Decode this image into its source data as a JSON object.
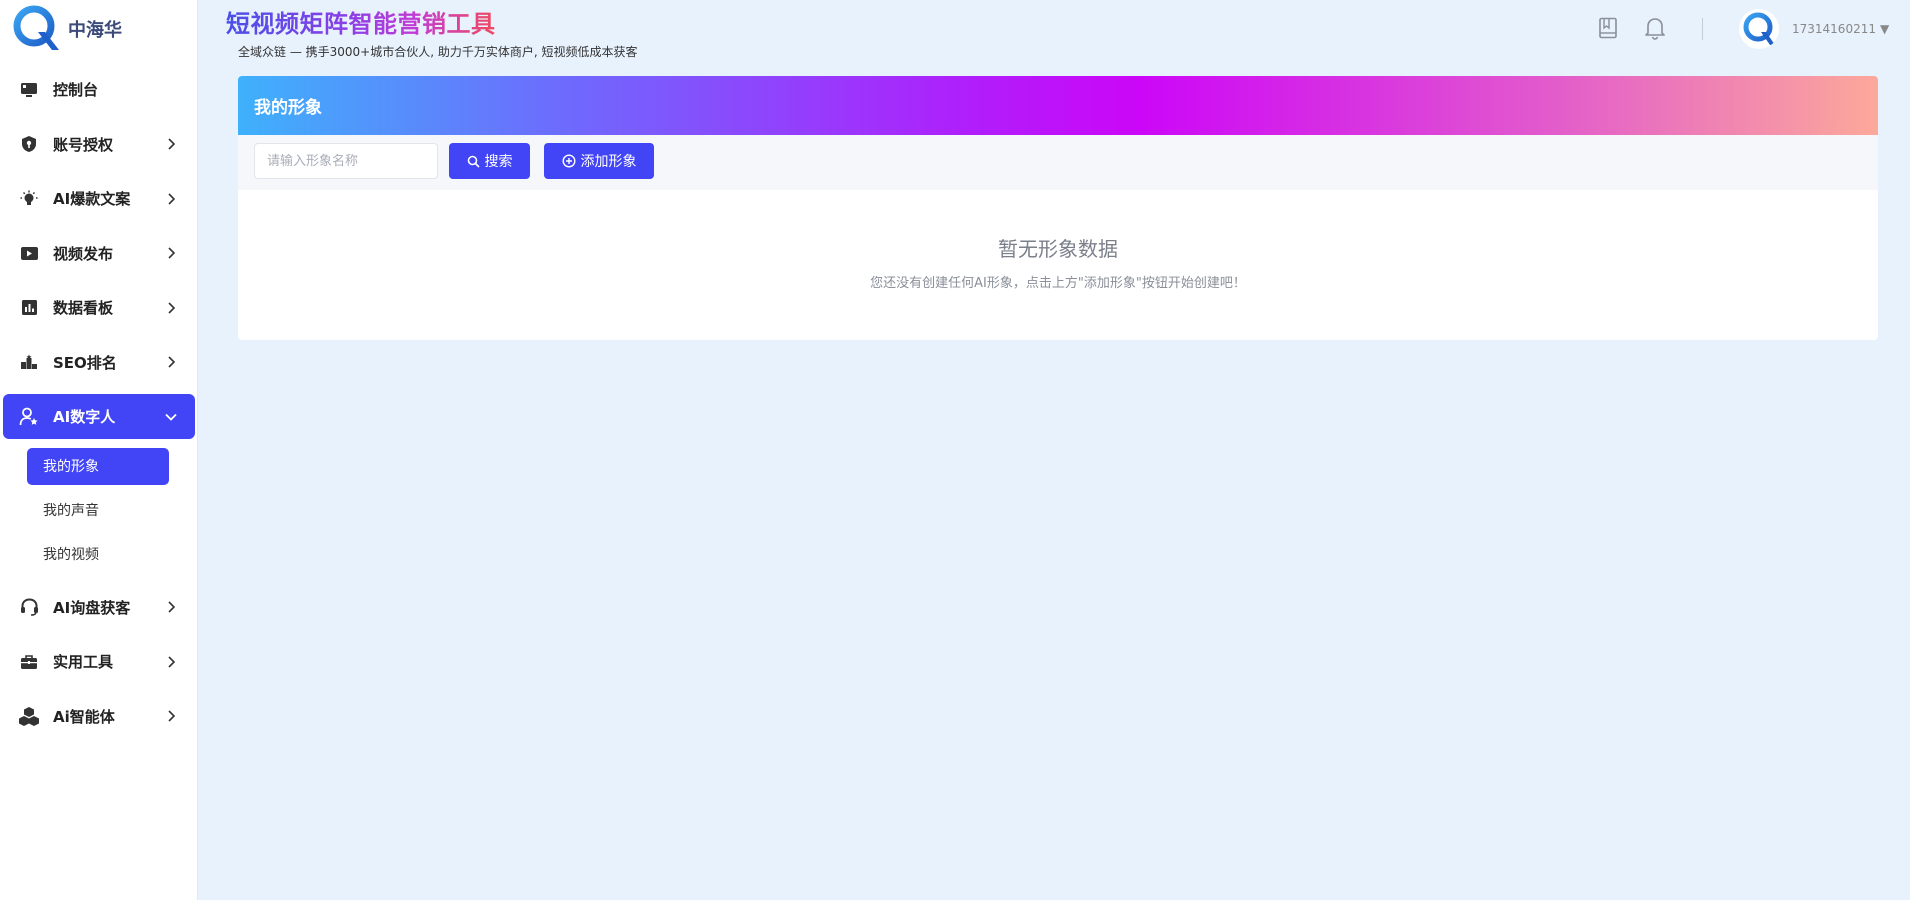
{
  "logo": {
    "text": "中海华"
  },
  "sidebar": {
    "items": [
      {
        "label": "控制台",
        "icon": "monitor-icon",
        "has_children": false
      },
      {
        "label": "账号授权",
        "icon": "shield-icon",
        "has_children": true
      },
      {
        "label": "AI爆款文案",
        "icon": "lightbulb-icon",
        "has_children": true
      },
      {
        "label": "视频发布",
        "icon": "video-icon",
        "has_children": true
      },
      {
        "label": "数据看板",
        "icon": "chart-icon",
        "has_children": true
      },
      {
        "label": "SEO排名",
        "icon": "podium-icon",
        "has_children": true
      },
      {
        "label": "AI数字人",
        "icon": "user-star-icon",
        "has_children": true,
        "active": true,
        "expanded": true
      },
      {
        "label": "AI询盘获客",
        "icon": "headset-icon",
        "has_children": true
      },
      {
        "label": "实用工具",
        "icon": "briefcase-icon",
        "has_children": true
      },
      {
        "label": "Ai智能体",
        "icon": "cubes-icon",
        "has_children": true
      }
    ],
    "submenu": [
      {
        "label": "我的形象",
        "active": true
      },
      {
        "label": "我的声音"
      },
      {
        "label": "我的视频"
      }
    ]
  },
  "header": {
    "title": "短视频矩阵智能营销工具",
    "subtitle": "全域众链 — 携手3000+城市合伙人, 助力千万实体商户, 短视频低成本获客",
    "user_phone": "17314160211",
    "caret": "▼"
  },
  "main": {
    "card_title": "我的形象",
    "search": {
      "placeholder": "请输入形象名称",
      "value": ""
    },
    "search_button": "搜索",
    "add_button": "添加形象",
    "empty_title": "暂无形象数据",
    "empty_desc": "您还没有创建任何AI形象，点击上方\"添加形象\"按钮开始创建吧！"
  },
  "colors": {
    "accent": "#4245f5",
    "background": "#e8f2fd"
  }
}
